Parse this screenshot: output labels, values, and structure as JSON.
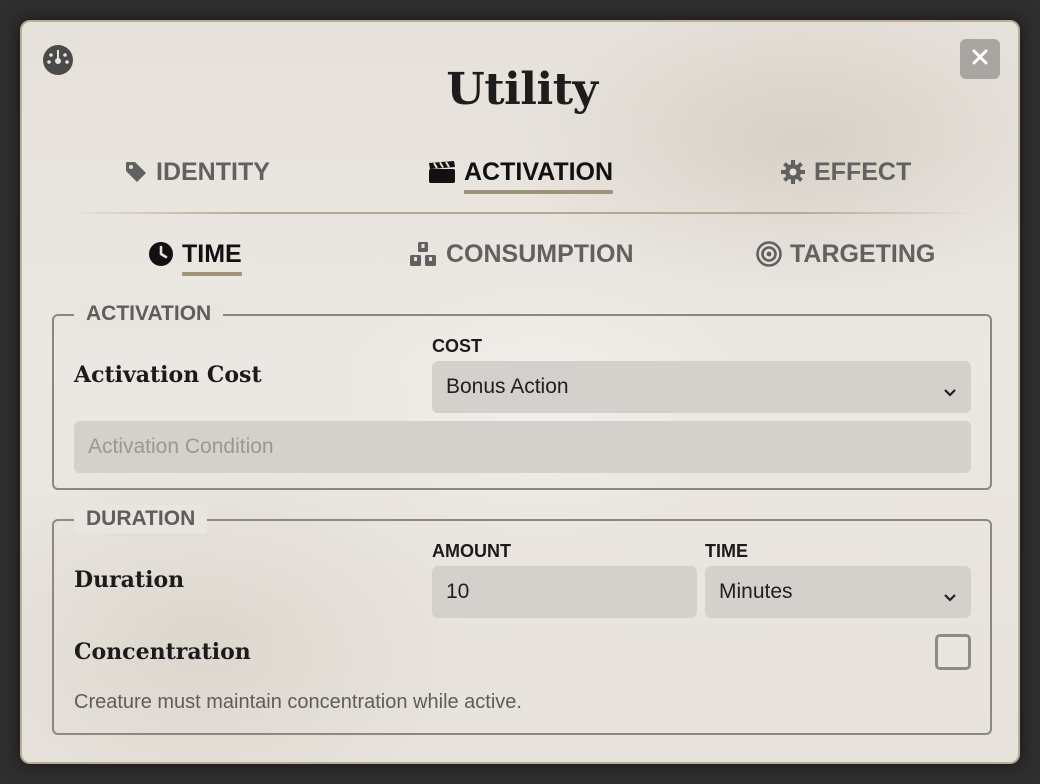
{
  "dialog": {
    "title": "Utility",
    "top_icon": "dashboard-gauge-icon",
    "close_icon": "close-icon"
  },
  "primary_tabs": [
    {
      "label": "IDENTITY",
      "icon": "tag-icon",
      "active": false
    },
    {
      "label": "ACTIVATION",
      "icon": "clapperboard-icon",
      "active": true
    },
    {
      "label": "EFFECT",
      "icon": "gear-icon",
      "active": false
    }
  ],
  "secondary_tabs": [
    {
      "label": "TIME",
      "icon": "clock-icon",
      "active": true
    },
    {
      "label": "CONSUMPTION",
      "icon": "cubes-icon",
      "active": false
    },
    {
      "label": "TARGETING",
      "icon": "target-icon",
      "active": false
    }
  ],
  "activation": {
    "legend": "ACTIVATION",
    "row_label": "Activation Cost",
    "cost_label": "COST",
    "cost_value": "Bonus Action",
    "condition_placeholder": "Activation Condition"
  },
  "duration": {
    "legend": "DURATION",
    "row_label": "Duration",
    "amount_label": "AMOUNT",
    "amount_value": "10",
    "time_label": "TIME",
    "time_value": "Minutes",
    "concentration_label": "Concentration",
    "concentration_checked": false,
    "concentration_hint": "Creature must maintain concentration while active."
  },
  "colors": {
    "accent_underline": "#9f927a",
    "frame_border": "#b9ad95",
    "field_bg": "#d4d0cb"
  }
}
